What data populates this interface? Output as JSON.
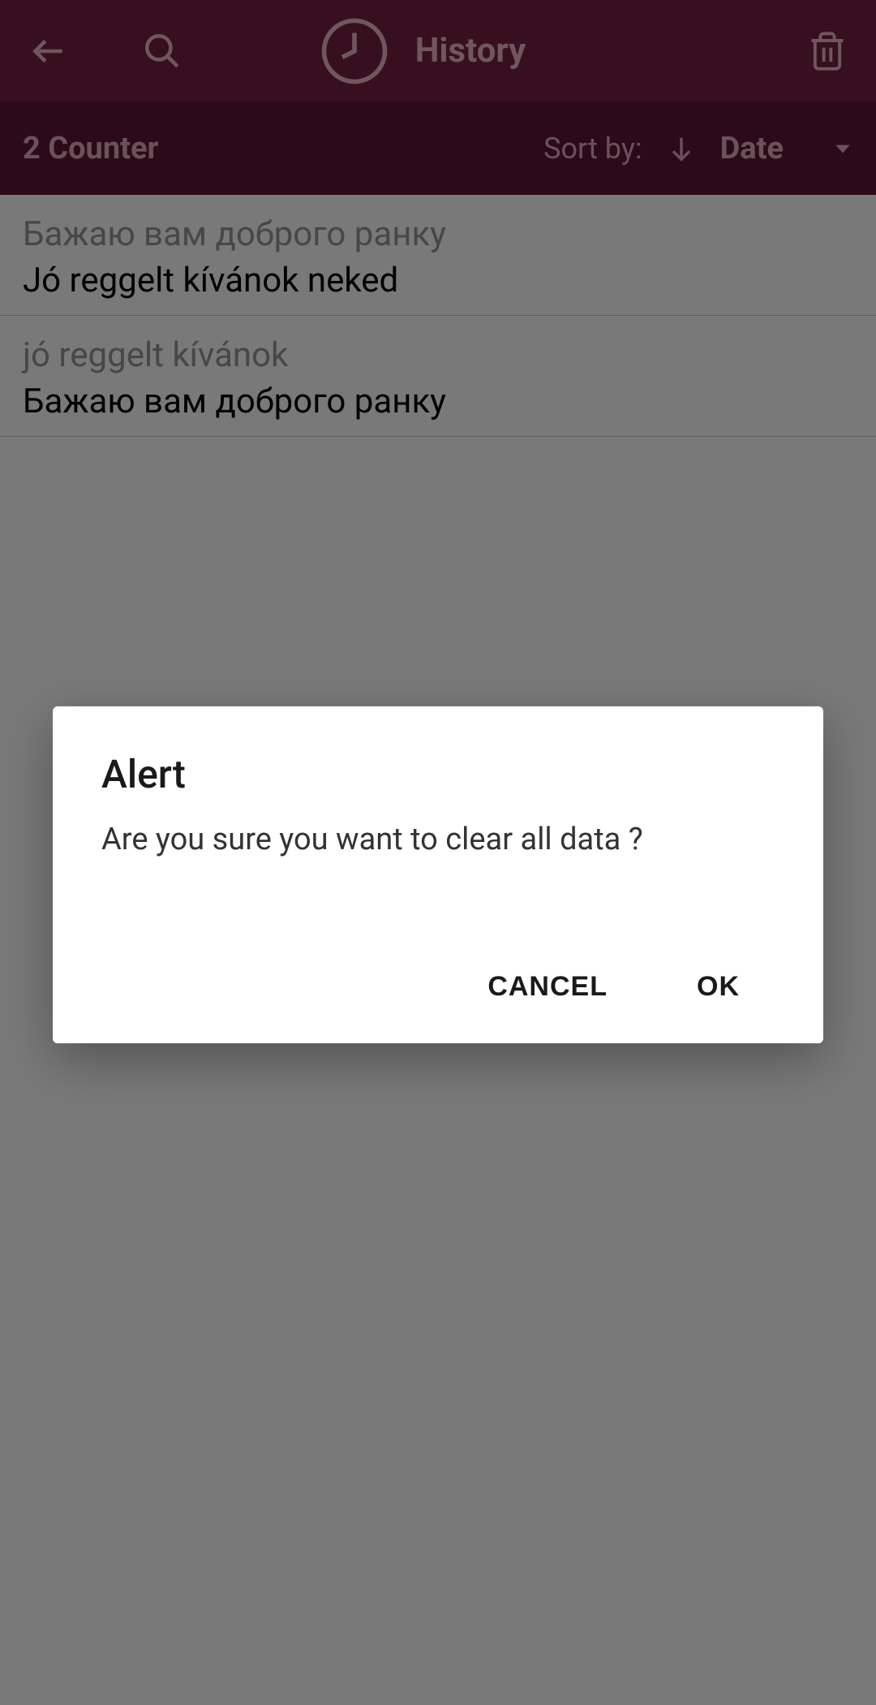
{
  "header": {
    "title": "History"
  },
  "subheader": {
    "counter": "2 Counter",
    "sort_label": "Sort by:",
    "sort_value": "Date"
  },
  "history_items": [
    {
      "source": "Бажаю вам доброго ранку",
      "translation": "Jó reggelt kívánok neked"
    },
    {
      "source": "jó reggelt kívánok",
      "translation": "Бажаю вам доброго ранку"
    }
  ],
  "dialog": {
    "title": "Alert",
    "message": "Are you sure you want to clear all data ?",
    "cancel": "CANCEL",
    "ok": "OK"
  }
}
